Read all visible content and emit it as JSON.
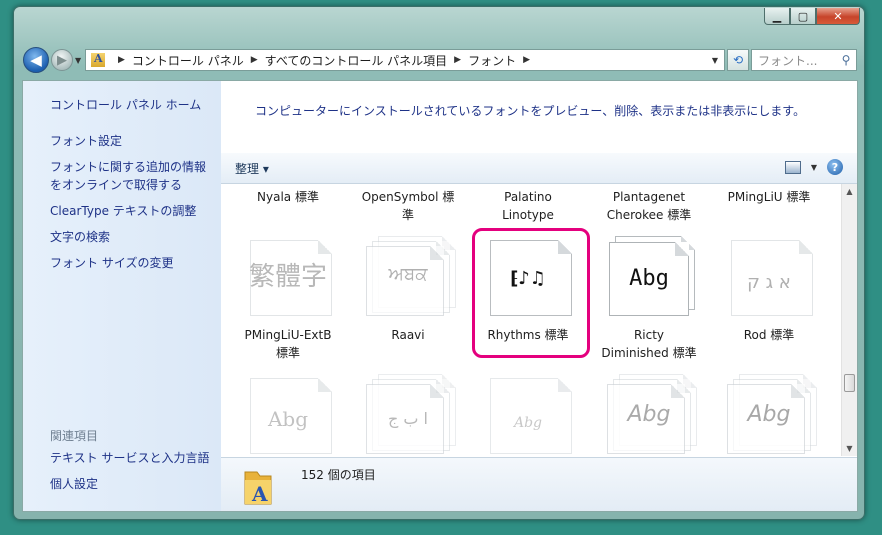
{
  "address": {
    "crumbs": [
      "コントロール パネル",
      "すべてのコントロール パネル項目",
      "フォント"
    ],
    "search_placeholder": "フォント..."
  },
  "sidebar": {
    "home": "コントロール パネル ホーム",
    "links": [
      "フォント設定",
      "フォントに関する追加の情報",
      "をオンラインで取得する",
      "ClearType テキストの調整",
      "文字の検索",
      "フォント サイズの変更"
    ],
    "related_header": "関連項目",
    "related": [
      "テキスト サービスと入力言語",
      "個人設定"
    ]
  },
  "banner": "コンピューターにインストールされているフォントをプレビュー、削除、表示または非表示にします。",
  "toolbar": {
    "organize": "整理 ▾",
    "help": "?"
  },
  "top_labels": [
    [
      "Nyala 標準",
      ""
    ],
    [
      "OpenSymbol 標",
      "準"
    ],
    [
      "Palatino",
      "Linotype"
    ],
    [
      "Plantagenet",
      "Cherokee 標準"
    ],
    [
      "PMingLiU 標準",
      ""
    ]
  ],
  "fonts_row2": [
    {
      "label1": "PMingLiU-ExtB",
      "label2": "標準",
      "glyph": "繁體字",
      "stack": false
    },
    {
      "label1": "Raavi",
      "label2": "",
      "glyph": "ਅਬਕ",
      "stack": true
    },
    {
      "label1": "Rhythms 標準",
      "label2": "",
      "glyph": "⁅♪♫",
      "stack": false,
      "selected": true
    },
    {
      "label1": "Ricty",
      "label2": "Diminished 標準",
      "glyph": "Abg",
      "stack": true
    },
    {
      "label1": "Rod 標準",
      "label2": "",
      "glyph": "א ג ק",
      "stack": false
    }
  ],
  "fonts_row3_glyphs": [
    "Abg",
    "ا ب ج",
    "Abg",
    "Abg",
    "Abg"
  ],
  "details": {
    "count": "152 個の項目"
  },
  "colors": {
    "selection": "#e4007e",
    "link": "#1e3287"
  }
}
